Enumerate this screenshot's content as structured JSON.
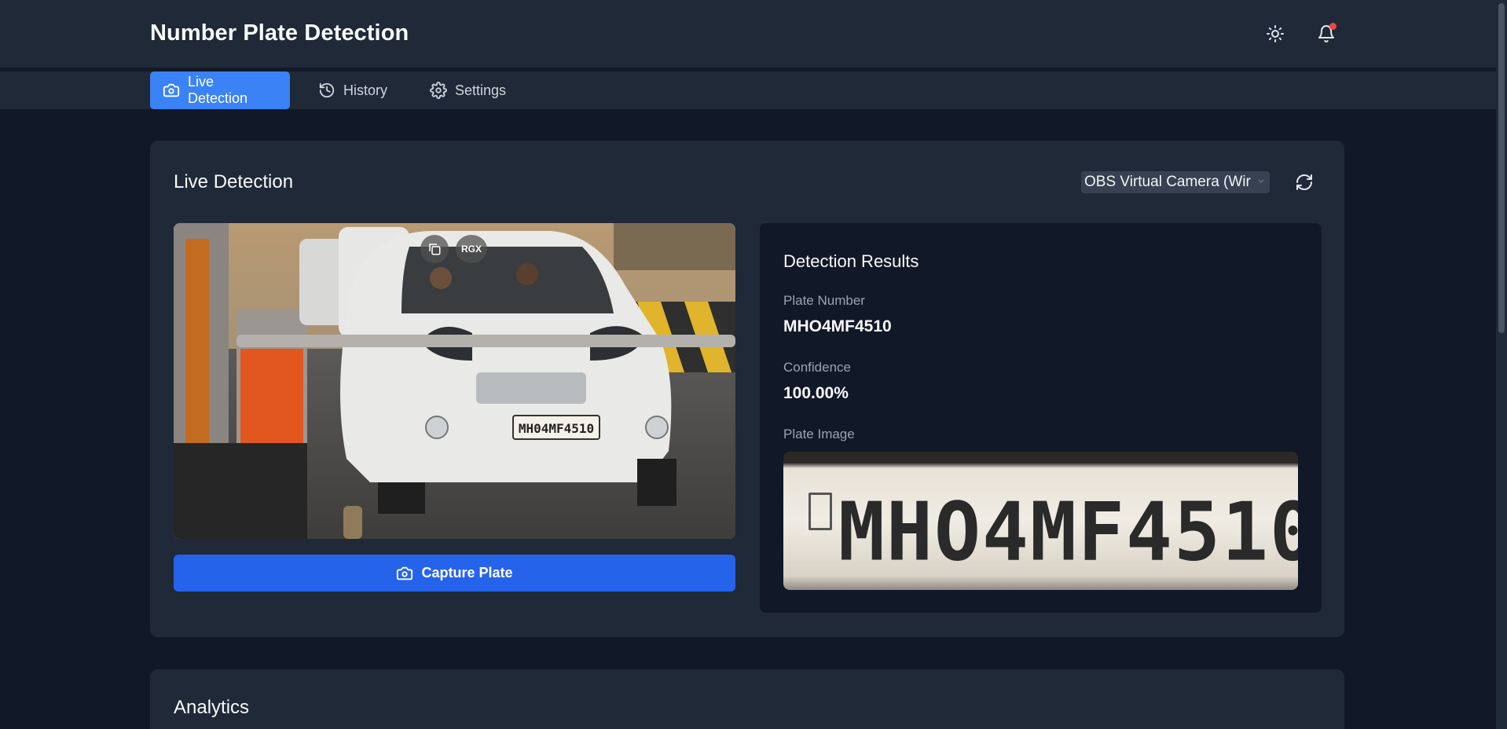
{
  "header": {
    "title": "Number Plate Detection",
    "theme_icon": "sun-icon",
    "notification_icon": "bell-icon"
  },
  "nav": {
    "tabs": [
      {
        "label": "Live Detection",
        "icon": "camera-icon",
        "active": true
      },
      {
        "label": "History",
        "icon": "history-icon",
        "active": false
      },
      {
        "label": "Settings",
        "icon": "gear-icon",
        "active": false
      }
    ]
  },
  "live": {
    "title": "Live Detection",
    "camera_select": "OBS Virtual Camera (Wir",
    "refresh_icon": "refresh-icon",
    "overlay_badge": "RGX",
    "feed_plate": "MH04MF4510",
    "capture_label": "Capture Plate"
  },
  "results": {
    "title": "Detection Results",
    "plate_number_label": "Plate Number",
    "plate_number": "MHO4MF4510",
    "confidence_label": "Confidence",
    "confidence": "100.00%",
    "plate_image_label": "Plate Image",
    "plate_image_text": "MHO4MF4510"
  },
  "analytics": {
    "title": "Analytics"
  },
  "colors": {
    "accent": "#3b82f6",
    "button": "#2563eb",
    "background": "#111827",
    "card": "#1f2937",
    "notification_dot": "#ef4444"
  }
}
